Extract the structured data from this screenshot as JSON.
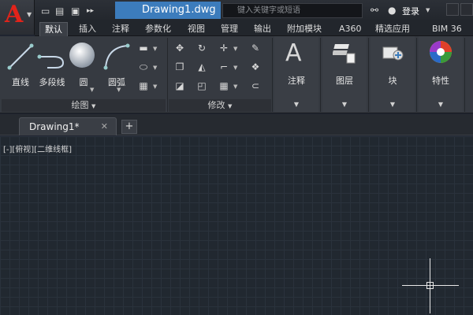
{
  "app": {
    "logo_letter": "A",
    "document_title": "Drawing1.dwg"
  },
  "search": {
    "placeholder": "键入关键字或短语"
  },
  "account": {
    "login_label": "登录"
  },
  "quick_access": {
    "icons": [
      "new-icon",
      "open-icon",
      "save-icon",
      "more-icon"
    ]
  },
  "tabs": [
    {
      "label": "默认"
    },
    {
      "label": "插入"
    },
    {
      "label": "注释"
    },
    {
      "label": "参数化"
    },
    {
      "label": "视图"
    },
    {
      "label": "管理"
    },
    {
      "label": "输出"
    },
    {
      "label": "附加模块"
    },
    {
      "label": "A360"
    },
    {
      "label": "精选应用"
    },
    {
      "label": "BIM 36"
    }
  ],
  "ribbon": {
    "draw_tools": [
      {
        "label": "直线",
        "icon": "line-icon"
      },
      {
        "label": "多段线",
        "icon": "polyline-icon"
      },
      {
        "label": "圆",
        "icon": "circle-icon"
      },
      {
        "label": "圆弧",
        "icon": "arc-icon"
      }
    ],
    "draw_panel_title": "绘图",
    "modify_panel_title": "修改",
    "sections": [
      {
        "label": "注释",
        "icon": "annotation-icon"
      },
      {
        "label": "图层",
        "icon": "layers-icon"
      },
      {
        "label": "块",
        "icon": "block-icon"
      },
      {
        "label": "特性",
        "icon": "properties-icon"
      }
    ]
  },
  "document_tab": {
    "label": "Drawing1*"
  },
  "canvas": {
    "viewport_label": "[-][俯视][二维线框]"
  },
  "colors": {
    "accent": "#3c7cbc",
    "logo": "#e2231a",
    "canvas_bg": "#212830"
  }
}
